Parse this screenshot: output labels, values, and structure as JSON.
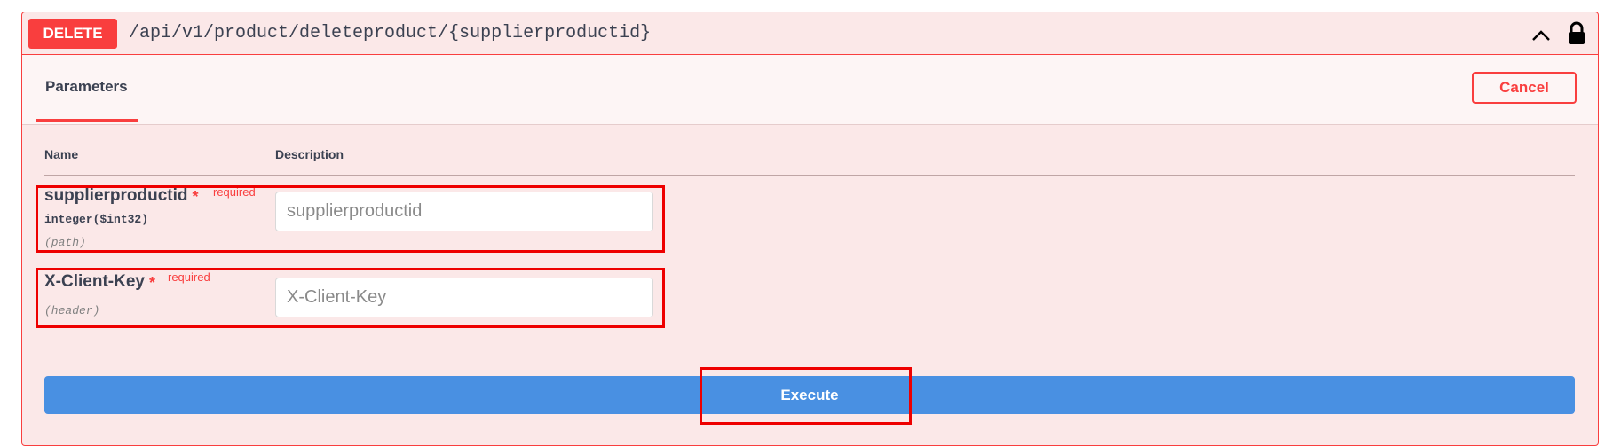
{
  "operation": {
    "method": "DELETE",
    "path": "/api/v1/product/deleteproduct/{supplierproductid}",
    "method_color": "#f93e3e",
    "icons": [
      "chevron-up-icon",
      "lock-icon"
    ]
  },
  "section": {
    "tab_label": "Parameters",
    "cancel_label": "Cancel"
  },
  "table": {
    "columns": [
      "Name",
      "Description"
    ]
  },
  "parameters": [
    {
      "name": "supplierproductid",
      "required_mark": "*",
      "required_label": "required",
      "type": "integer($int32)",
      "location": "(path)",
      "placeholder": "supplierproductid",
      "value": ""
    },
    {
      "name": "X-Client-Key",
      "required_mark": "*",
      "required_label": "required",
      "type": "",
      "location": "(header)",
      "placeholder": "X-Client-Key",
      "value": ""
    }
  ],
  "actions": {
    "execute_label": "Execute",
    "execute_color": "#4990e2"
  }
}
